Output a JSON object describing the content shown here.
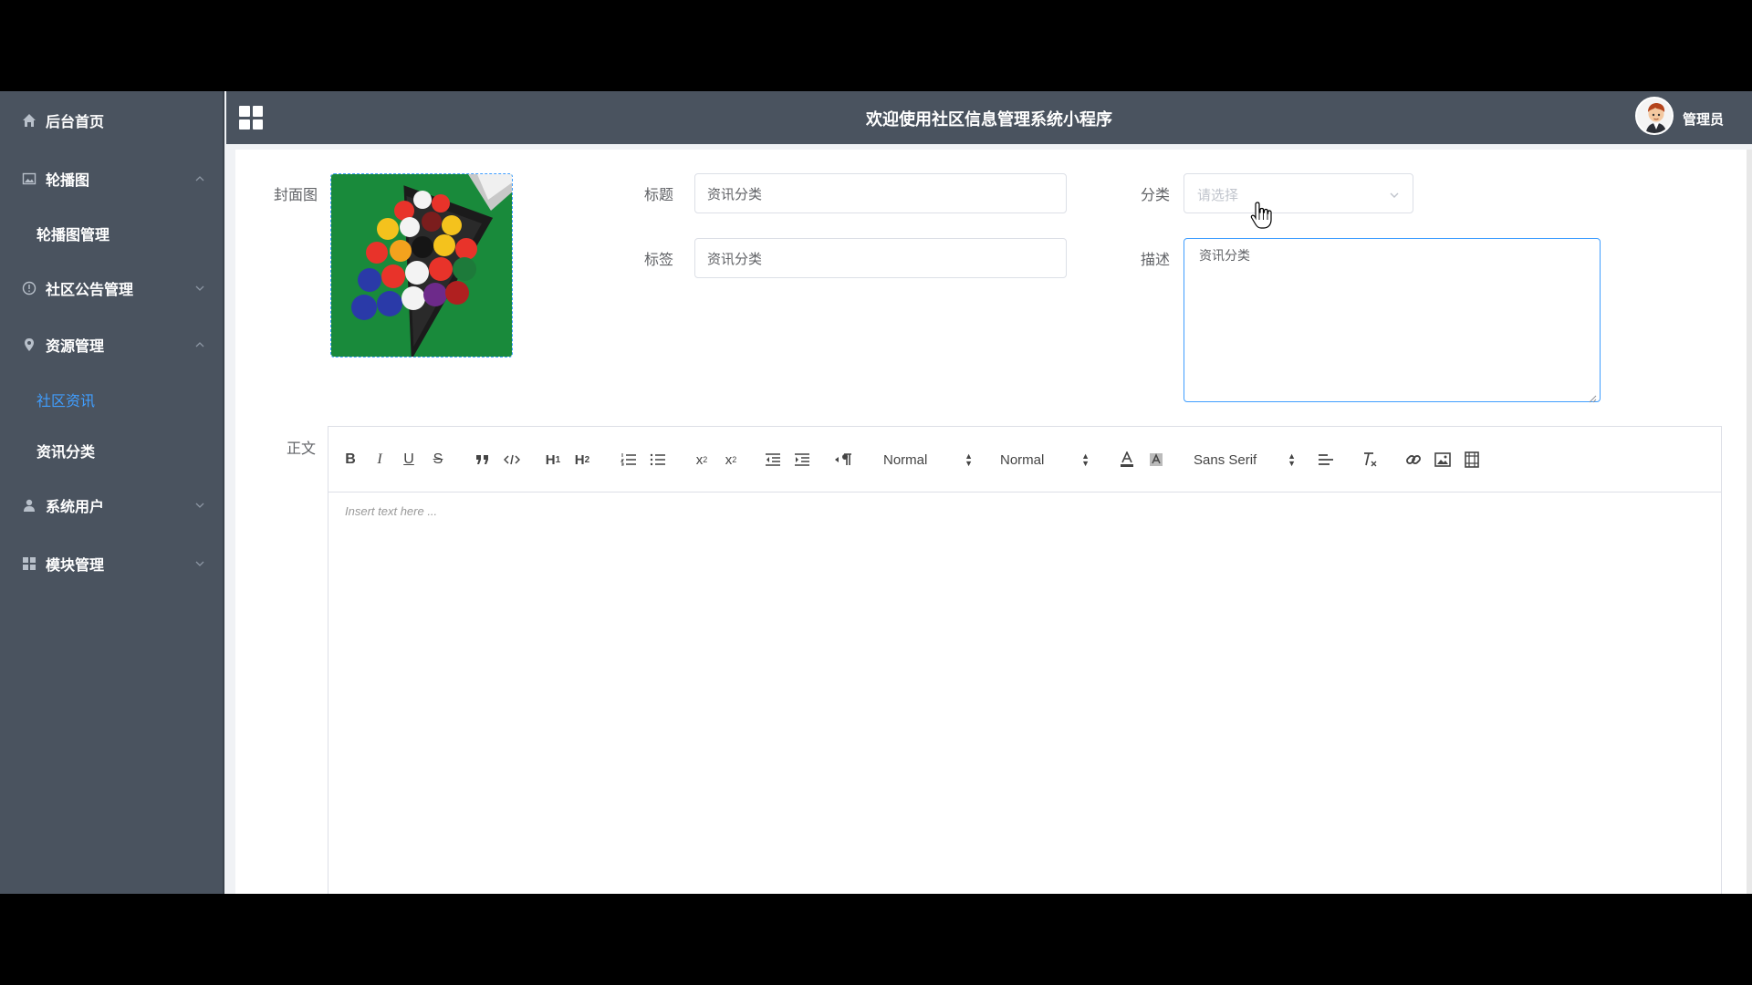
{
  "sidebar": {
    "items": [
      {
        "label": "后台首页",
        "icon": "home-icon"
      },
      {
        "label": "轮播图",
        "icon": "image-icon",
        "expanded": true,
        "children": [
          "轮播图管理"
        ]
      },
      {
        "label": "社区公告管理",
        "icon": "info-circle-icon",
        "expanded": false
      },
      {
        "label": "资源管理",
        "icon": "location-icon",
        "expanded": true,
        "children": [
          "社区资讯",
          "资讯分类"
        ]
      },
      {
        "label": "系统用户",
        "icon": "user-icon",
        "expanded": false
      },
      {
        "label": "模块管理",
        "icon": "grid-icon",
        "expanded": false
      }
    ],
    "active_sub": "社区资讯"
  },
  "header": {
    "title": "欢迎使用社区信息管理系统小程序",
    "user": "管理员"
  },
  "form": {
    "cover_label": "封面图",
    "title_label": "标题",
    "title_value": "资讯分类",
    "tag_label": "标签",
    "tag_value": "资讯分类",
    "category_label": "分类",
    "category_placeholder": "请选择",
    "desc_label": "描述",
    "desc_value": "资讯分类",
    "body_label": "正文"
  },
  "editor": {
    "header_picker": "Normal",
    "size_picker": "Normal",
    "font_picker": "Sans Serif",
    "placeholder": "Insert text here ..."
  },
  "colors": {
    "sidebar_bg": "#4a535f",
    "active": "#409eff",
    "border": "#dcdfe6"
  }
}
